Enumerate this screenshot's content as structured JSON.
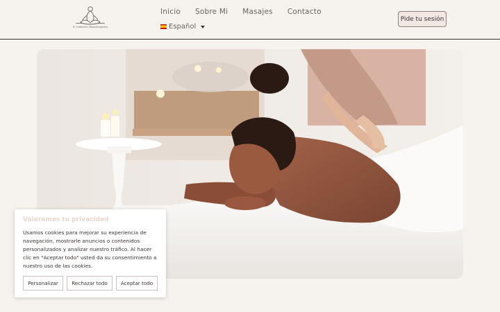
{
  "header": {
    "logo_caption": "E. Gutiérrez Masoterapeuta",
    "nav": [
      "Inicio",
      "Sobre Mi",
      "Masajes",
      "Contacto"
    ],
    "language": "Español",
    "cta_label": "Pide tu sesión"
  },
  "hero": {
    "image": "woman-receiving-back-massage"
  },
  "cookie": {
    "title": "Valoramos tu privacidad",
    "body": "Usamos cookies para mejorar su experiencia de navegación, mostrarle anuncios o contenidos personalizados y analizar nuestro tráfico. Al hacer clic en \"Aceptar todo\" usted da su consentimiento a nuestro uso de las cookies.",
    "buttons": {
      "customize": "Personalizar",
      "reject": "Rechazar todo",
      "accept": "Aceptar todo"
    }
  },
  "colors": {
    "background": "#f6f2ee",
    "header_border": "#3b3431",
    "cookie_title": "#e8d6cf",
    "cta_bg": "#f1e8e3"
  }
}
